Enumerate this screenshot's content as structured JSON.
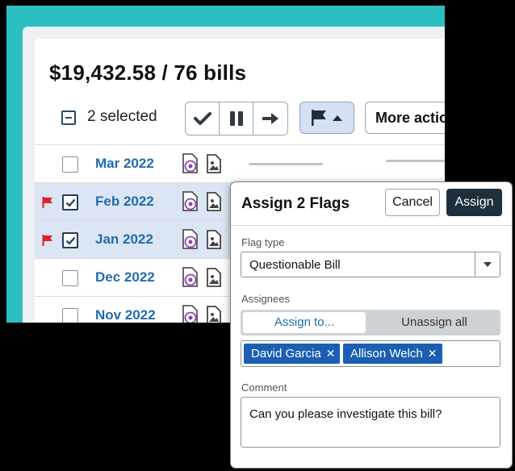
{
  "summary": "$19,432.58 / 76 bills",
  "selection": {
    "count_label": "2 selected"
  },
  "toolbar": {
    "approve_icon": "checkmark-icon",
    "hold_icon": "pause-icon",
    "forward_icon": "arrow-right-icon",
    "flag_icon": "flag-icon",
    "more_actions_label": "More actio"
  },
  "rows": [
    {
      "date": "Mar 2022",
      "selected": false,
      "flagged": false
    },
    {
      "date": "Feb 2022",
      "selected": true,
      "flagged": true
    },
    {
      "date": "Jan 2022",
      "selected": true,
      "flagged": true
    },
    {
      "date": "Dec 2022",
      "selected": false,
      "flagged": false
    },
    {
      "date": "Nov 2022",
      "selected": false,
      "flagged": false
    }
  ],
  "dialog": {
    "title": "Assign 2 Flags",
    "cancel_label": "Cancel",
    "assign_label": "Assign",
    "flag_type_label": "Flag type",
    "flag_type_value": "Questionable Bill",
    "assignees_label": "Assignees",
    "assign_to_label": "Assign to...",
    "unassign_all_label": "Unassign all",
    "assignees": [
      "David Garcia",
      "Allison Welch"
    ],
    "comment_label": "Comment",
    "comment_value": "Can you please investigate this bill?"
  },
  "colors": {
    "accent": "#1f6cb0",
    "teal_background": "#2bbfc2",
    "flag_red": "#e0202a",
    "chip_blue": "#1a5fb4",
    "primary_button": "#1e2f3c"
  }
}
